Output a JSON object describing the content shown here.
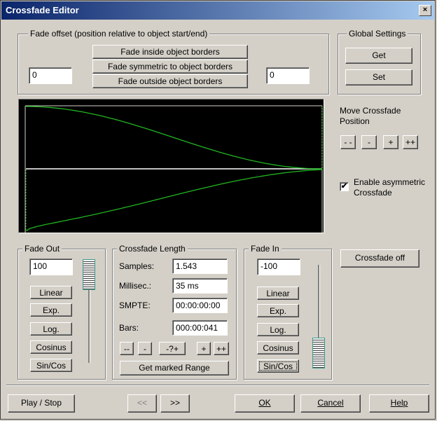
{
  "window": {
    "title": "Crossfade Editor",
    "close_glyph": "×"
  },
  "fade_offset": {
    "label": "Fade offset  (position relative to object start/end)",
    "left_value": "0",
    "right_value": "0",
    "buttons": [
      "Fade inside object borders",
      "Fade symmetric to object borders",
      "Fade outside object borders"
    ]
  },
  "global_settings": {
    "label": "Global Settings",
    "get_label": "Get",
    "set_label": "Set"
  },
  "move_crossfade": {
    "label_line1": "Move Crossfade",
    "label_line2": "Position",
    "buttons": [
      "- -",
      "-",
      "+",
      "++"
    ]
  },
  "asymmetric": {
    "label_line1": "Enable asymmetric",
    "label_line2": "Crossfade",
    "checked": true,
    "check_glyph": "✔"
  },
  "crossfade_off_label": "Crossfade off",
  "fade_out": {
    "label": "Fade Out",
    "value": "100",
    "buttons": [
      "Linear",
      "Exp.",
      "Log.",
      "Cosinus",
      "Sin/Cos"
    ],
    "slider_level": 1.0
  },
  "crossfade_length": {
    "label": "Crossfade Length",
    "rows": [
      {
        "label": "Samples:",
        "value": "1.543"
      },
      {
        "label": "Millisec.:",
        "value": "35 ms"
      },
      {
        "label": "SMPTE:",
        "value": "00:00:00:00"
      },
      {
        "label": "Bars:",
        "value": "000:00:041"
      }
    ],
    "nudge_buttons": [
      "--",
      "-",
      "-?+",
      "+",
      "++"
    ],
    "marked_range_label": "Get marked Range"
  },
  "fade_in": {
    "label": "Fade In",
    "value": "-100",
    "buttons": [
      "Linear",
      "Exp.",
      "Log.",
      "Cosinus",
      "Sin/Cos"
    ],
    "slider_level": 0.0
  },
  "footer": {
    "play_label": "Play / Stop",
    "prev_label": "<<",
    "next_label": ">>",
    "ok_label": "OK",
    "cancel_label": "Cancel",
    "help_label": "Help"
  },
  "colors": {
    "curve": "#21b521",
    "display_bg": "#000000",
    "title_start": "#0a246a",
    "title_end": "#a6caf0"
  }
}
